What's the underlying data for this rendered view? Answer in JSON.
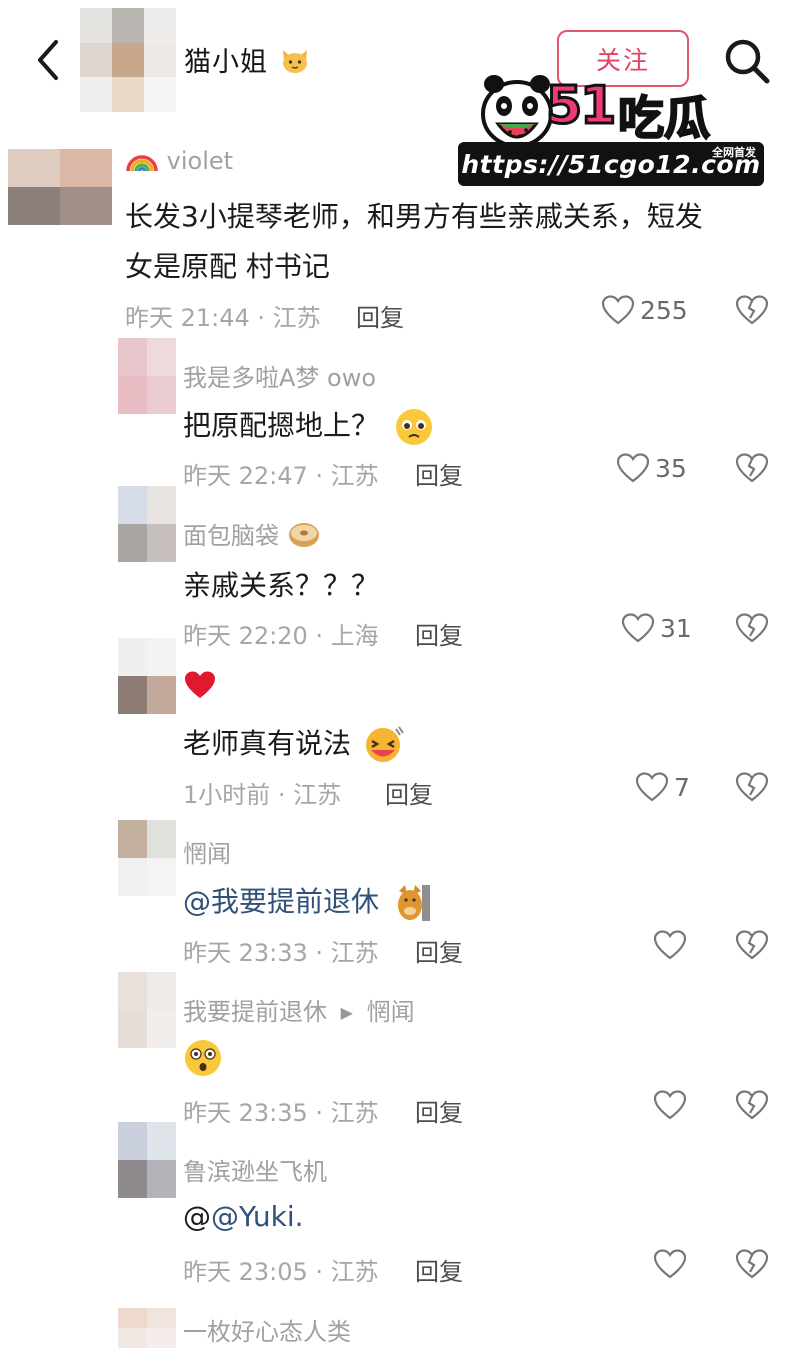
{
  "header": {
    "title": "猫小姐",
    "title_emoji": "cat-face-emoji",
    "follow_label": "关注",
    "back_icon": "chevron-left-icon",
    "search_icon": "search-icon"
  },
  "watermark": {
    "brand_digits": "51",
    "brand_text": "吃瓜",
    "tag": "全网首发",
    "url": "https://51cgo12.com"
  },
  "comments": [
    {
      "user": "violet",
      "user_badge": "rainbow-emoji",
      "text": "长发3小提琴老师，和男方有些亲戚关系，短发",
      "text_line2": "女是原配 村书记",
      "time": "昨天 21:44 · 江苏",
      "reply_label": "回复",
      "likes": "255"
    },
    {
      "user": "我是多啦A梦 owo",
      "text": "把原配摁地上？",
      "text_emoji": "pleading-face-emoji",
      "time": "昨天 22:47 · 江苏",
      "reply_label": "回复",
      "likes": "35"
    },
    {
      "user": "面包脑袋",
      "user_badge": "bagel-emoji",
      "text": "亲戚关系？？？",
      "time": "昨天 22:20 · 上海",
      "reply_label": "回复",
      "likes": "31"
    },
    {
      "user": "",
      "user_badge": "red-heart-emoji",
      "text": "老师真有说法",
      "text_emoji": "grinning-squint-emoji",
      "time": "1小时前 · 江苏",
      "reply_label": "回复",
      "likes": "7"
    },
    {
      "user": "惘闻",
      "text": "@我要提前退休",
      "text_emoji": "cat-sticker-emoji",
      "time": "昨天 23:33 · 江苏",
      "reply_label": "回复",
      "likes": ""
    },
    {
      "user": "我要提前退休",
      "reply_to": "惘闻",
      "text": "",
      "text_emoji": "shocked-face-emoji",
      "time": "昨天 23:35 · 江苏",
      "reply_label": "回复",
      "likes": ""
    },
    {
      "user": "鲁滨逊坐飞机",
      "text": "@",
      "text_mention": "@Yuki.",
      "time": "昨天 23:05 · 江苏",
      "reply_label": "回复",
      "likes": ""
    },
    {
      "user": "一枚好心态人类",
      "text": "",
      "time": "",
      "reply_label": "",
      "likes": ""
    }
  ]
}
